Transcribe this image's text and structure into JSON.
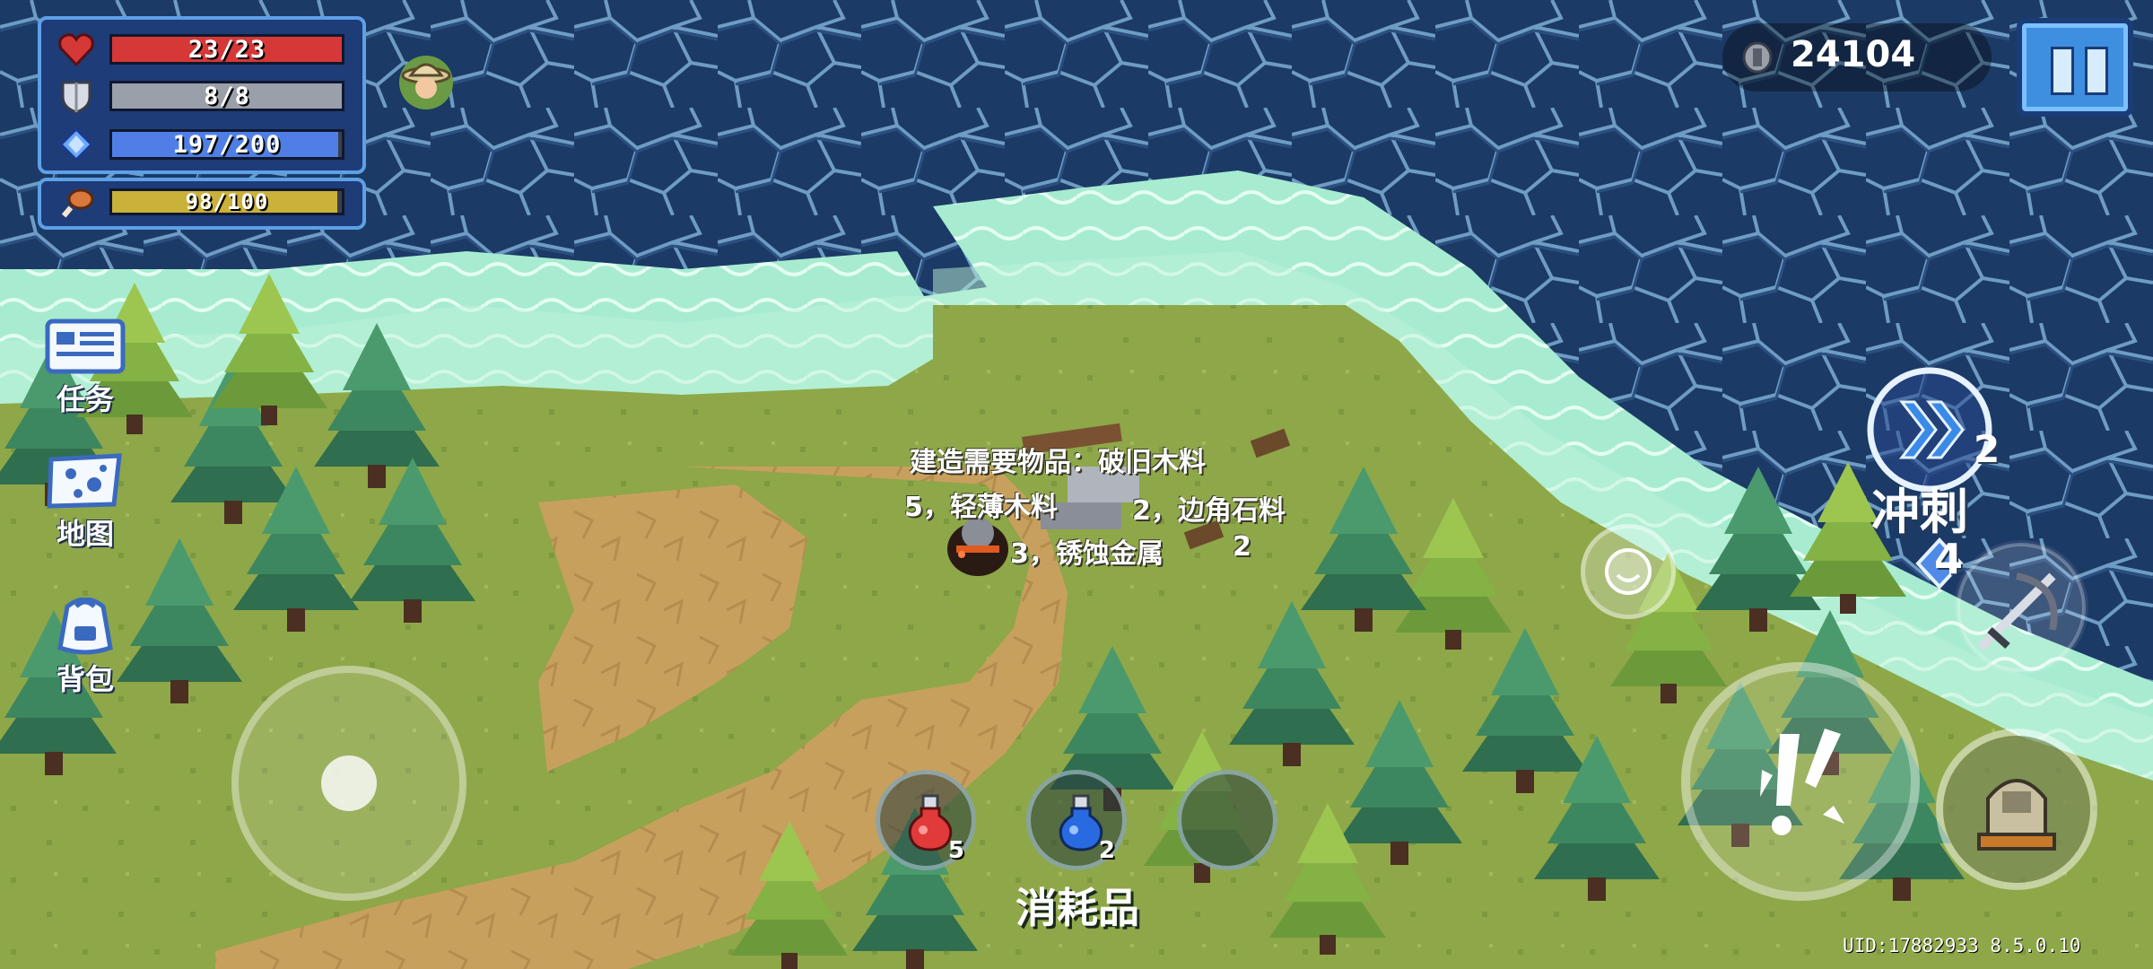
{
  "colors": {
    "health": "#d63838",
    "armor": "#9aa0aa",
    "energy": "#4f7fe6",
    "hunger": "#c9b13a",
    "hud_panel": "#1d3c78",
    "hud_border": "#5ea0e6",
    "deep_water": "#1c3a66",
    "shallow_water": "#8fe0c0",
    "grass": "#8ea748",
    "dirt": "#c8a05e"
  },
  "stats": {
    "health": {
      "icon": "heart-icon",
      "current": 23,
      "max": 23,
      "text": "23/23"
    },
    "armor": {
      "icon": "shield-icon",
      "current": 8,
      "max": 8,
      "text": "8/8"
    },
    "energy": {
      "icon": "energy-crystal-icon",
      "current": 197,
      "max": 200,
      "text": "197/200"
    },
    "hunger": {
      "icon": "drumstick-icon",
      "current": 98,
      "max": 100,
      "text": "98/100"
    }
  },
  "currency": {
    "icon": "gem-icon",
    "value": "24104"
  },
  "menu": [
    {
      "id": "quests",
      "label": "任务",
      "icon": "quest-board-icon"
    },
    {
      "id": "map",
      "label": "地图",
      "icon": "map-icon"
    },
    {
      "id": "backpack",
      "label": "背包",
      "icon": "backpack-icon"
    }
  ],
  "build_prompt": {
    "line1": "建造需要物品：破旧木料",
    "line2": "5，轻薄木料",
    "line2b": "2，边角石料",
    "line3": "3，锈蚀金属",
    "line3b": "2"
  },
  "consumables": {
    "label": "消耗品",
    "slots": [
      {
        "icon": "red-potion-icon",
        "count": "5"
      },
      {
        "icon": "blue-potion-icon",
        "count": "2"
      },
      {
        "icon": "empty-slot",
        "count": ""
      }
    ]
  },
  "skills": {
    "dash_label": "冲刺",
    "dash_count": "2",
    "energy_cost": "4"
  },
  "uid": "UID:17882933 8.5.0.10"
}
